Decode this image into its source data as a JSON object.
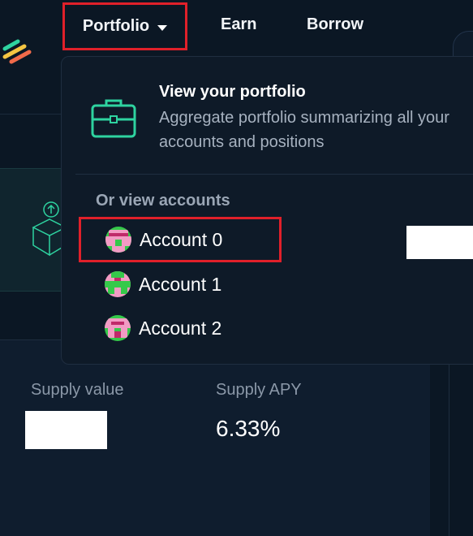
{
  "nav": {
    "portfolio_label": "Portfolio",
    "earn_label": "Earn",
    "borrow_label": "Borrow"
  },
  "dropdown": {
    "title": "View your portfolio",
    "description": "Aggregate portfolio summarizing all your accounts and positions",
    "section_label": "Or view accounts",
    "accounts": [
      {
        "label": "Account 0"
      },
      {
        "label": "Account 1"
      },
      {
        "label": "Account 2"
      }
    ]
  },
  "stats": {
    "supply_value_label": "Supply value",
    "supply_apy_label": "Supply APY",
    "supply_apy_value": "6.33%"
  },
  "icons": {
    "logo": "logo-icon",
    "briefcase": "briefcase-icon",
    "caret": "caret-down-icon",
    "cube": "cube-upload-icon"
  },
  "colors": {
    "background": "#0b1724",
    "accent_green": "#2ed3a0",
    "highlight_red": "#e0202a"
  }
}
